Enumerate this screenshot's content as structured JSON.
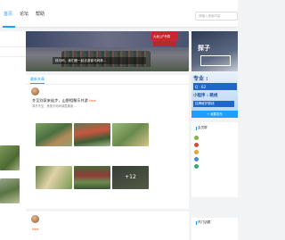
{
  "nav": {
    "items": [
      "首页",
      "论坛",
      "帮助"
    ]
  },
  "search": {
    "placeholder": "请输入搜索内容"
  },
  "left": {
    "rows": [
      "",
      "",
      "",
      "",
      "",
      "",
      "",
      ""
    ],
    "thumb_caption": ""
  },
  "banner": {
    "caption": "徐马坞，我们爱一起去游徐马坞林…",
    "flag": "大龙山户外群"
  },
  "ad_right": {
    "big": "探子",
    "box": ""
  },
  "promo": {
    "line1": "专业 :",
    "line2": "Q : 62",
    "line3": "小程序 : 跳线",
    "line4": "挂牌维护跳线"
  },
  "promo_button": "+ 我要发布",
  "feed": {
    "tab": "最新文章",
    "post1": {
      "user": "",
      "meta": "",
      "title": "冬至别家来徒步，山野相聚乐共游",
      "tag": "New",
      "excerpt": "寒冬冬至，美丽天地间绿茵拂面 …",
      "more_count": "+12"
    },
    "post2": {
      "user": "",
      "meta": "",
      "title": "",
      "tag": "New",
      "excerpt": ""
    }
  },
  "members": {
    "heading": "会员群",
    "list": [
      "",
      "",
      "",
      "",
      ""
    ]
  },
  "logos": {
    "rows": [
      "",
      "",
      "",
      ""
    ]
  },
  "hot": {
    "heading": "热门话题"
  },
  "colors": {
    "accent": "#1e9fff",
    "tag": "#ff5722",
    "banner_flag": "#c8262b"
  }
}
